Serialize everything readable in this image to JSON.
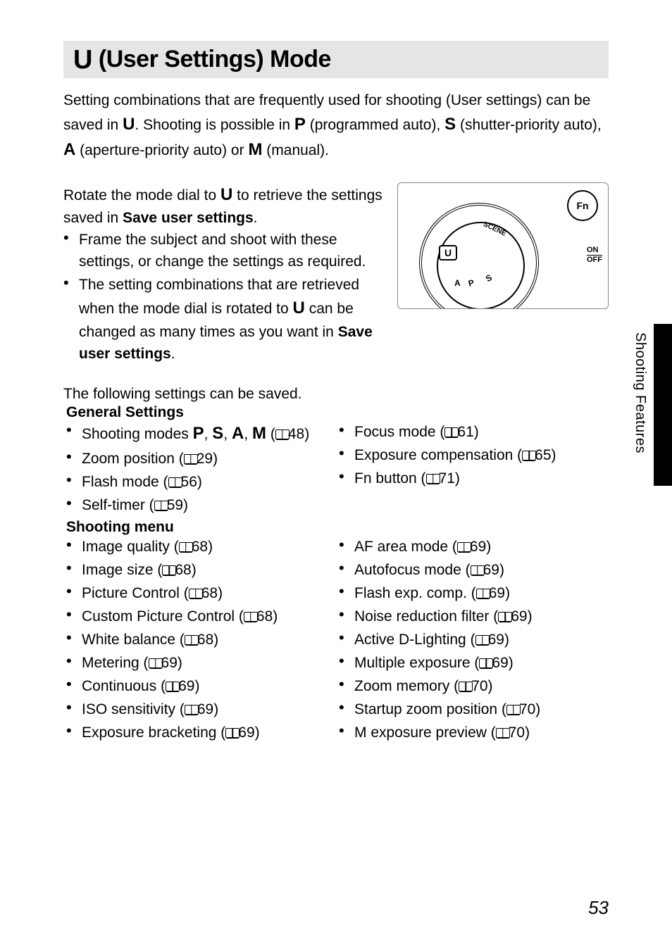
{
  "title": {
    "mode_glyph": "U",
    "text": " (User Settings) Mode"
  },
  "intro": {
    "t1": "Setting combinations that are frequently used for shooting (User settings) can be saved in ",
    "u": "U",
    "t2": ". Shooting is possible in ",
    "p": "P",
    "t3": " (programmed auto), ",
    "s": "S",
    "t4": " (shutter-priority auto), ",
    "a": "A",
    "t5": " (aperture-priority auto) or ",
    "m": "M",
    "t6": " (manual)."
  },
  "rotate": {
    "t1": "Rotate the mode dial to ",
    "u": "U",
    "t2": " to retrieve the settings saved in ",
    "bold": "Save user settings",
    "t3": "."
  },
  "rotate_bullets": {
    "b1": "Frame the subject and shoot with these settings, or change the settings as required.",
    "b2a": "The setting combinations that are retrieved when the mode dial is rotated to ",
    "b2u": "U",
    "b2b": " can be changed as many times as you want in ",
    "b2bold": "Save user settings",
    "b2c": "."
  },
  "illu": {
    "fn": "Fn",
    "on": "ON",
    "off": "OFF",
    "u": "U",
    "scene": "SCENE"
  },
  "savable_intro": "The following settings can be saved.",
  "general_heading": "General Settings",
  "shooting_heading": "Shooting menu",
  "general_left": [
    {
      "pre": "Shooting modes ",
      "modes": "P, S, A, M",
      "ref": "48"
    },
    {
      "pre": "Zoom position",
      "ref": "29"
    },
    {
      "pre": "Flash mode",
      "ref": "56"
    },
    {
      "pre": "Self-timer",
      "ref": "59"
    }
  ],
  "general_right": [
    {
      "pre": "Focus mode",
      "ref": "61"
    },
    {
      "pre": "Exposure compensation",
      "ref": "65"
    },
    {
      "pre": "Fn button",
      "ref": "71"
    }
  ],
  "shooting_left": [
    {
      "pre": "Image quality",
      "ref": "68"
    },
    {
      "pre": "Image size",
      "ref": "68"
    },
    {
      "pre": "Picture Control",
      "ref": "68"
    },
    {
      "pre": "Custom Picture Control",
      "ref": "68"
    },
    {
      "pre": "White balance",
      "ref": "68"
    },
    {
      "pre": "Metering",
      "ref": "69"
    },
    {
      "pre": "Continuous",
      "ref": "69"
    },
    {
      "pre": "ISO sensitivity",
      "ref": "69"
    },
    {
      "pre": "Exposure bracketing",
      "ref": "69"
    }
  ],
  "shooting_right": [
    {
      "pre": "AF area mode",
      "ref": "69"
    },
    {
      "pre": "Autofocus mode",
      "ref": "69"
    },
    {
      "pre": "Flash exp. comp.",
      "ref": "69"
    },
    {
      "pre": "Noise reduction filter",
      "ref": "69"
    },
    {
      "pre": "Active D-Lighting",
      "ref": "69"
    },
    {
      "pre": "Multiple exposure",
      "ref": "69"
    },
    {
      "pre": "Zoom memory",
      "ref": "70"
    },
    {
      "pre": "Startup zoom position",
      "ref": "70"
    },
    {
      "pre": "M exposure preview",
      "ref": "70"
    }
  ],
  "side_label": "Shooting Features",
  "page_number": "53"
}
